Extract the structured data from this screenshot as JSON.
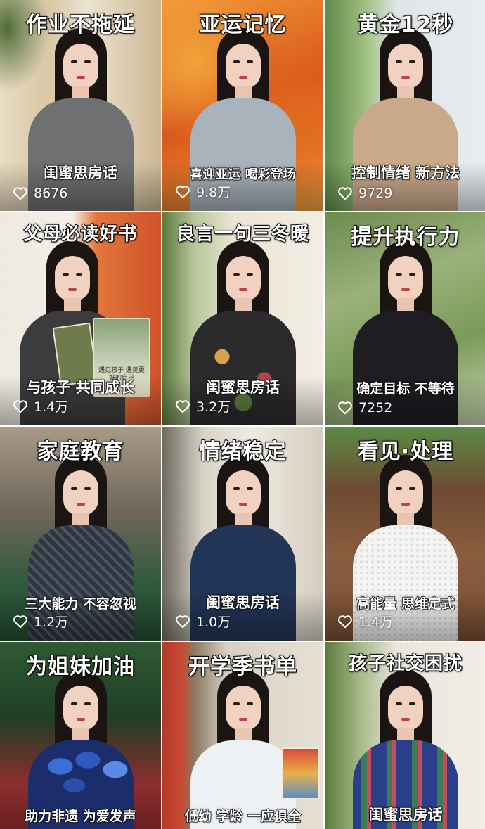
{
  "videos": [
    {
      "title": "作业不拖延",
      "caption": "闺蜜思房话",
      "likes": "8676",
      "like_icon": "heart-outline-icon"
    },
    {
      "title": "亚运记忆",
      "caption": "喜迎亚运  喝彩登场",
      "likes": "9.8万",
      "like_icon": "heart-outline-icon"
    },
    {
      "title": "黄金12秒",
      "caption": "控制情绪 新方法",
      "likes": "9729",
      "like_icon": "heart-outline-icon"
    },
    {
      "title": "父母必读好书",
      "caption": "与孩子 共同成长",
      "likes": "1.4万",
      "like_icon": "heart-outline-icon"
    },
    {
      "title": "良言一句三冬暖",
      "caption": "闺蜜思房话",
      "likes": "3.2万",
      "like_icon": "heart-outline-icon"
    },
    {
      "title": "提升执行力",
      "caption": "确定目标  不等待",
      "likes": "7252",
      "like_icon": "heart-outline-icon"
    },
    {
      "title": "家庭教育",
      "caption": "三大能力 不容忽视",
      "likes": "1.2万",
      "like_icon": "heart-outline-icon"
    },
    {
      "title": "情绪稳定",
      "caption": "闺蜜思房话",
      "likes": "1.0万",
      "like_icon": "heart-outline-icon"
    },
    {
      "title": "看见·处理",
      "caption": "高能量 思维定式",
      "likes": "1.4万",
      "like_icon": "heart-outline-icon"
    },
    {
      "title": "为姐妹加油",
      "caption": "助力非遗 为爱发声",
      "likes": "",
      "like_icon": ""
    },
    {
      "title": "开学季书单",
      "caption": "低幼 学龄 一应俱全",
      "likes": "",
      "like_icon": ""
    },
    {
      "title": "孩子社交困扰",
      "caption": "闺蜜思房话",
      "likes": "",
      "like_icon": ""
    }
  ],
  "book_cover_text": "遇见孩子 遇见更好的自己",
  "colors": {
    "title_text": "#ffffff",
    "title_stroke": "#111111",
    "likes_text": "#ffffff"
  }
}
